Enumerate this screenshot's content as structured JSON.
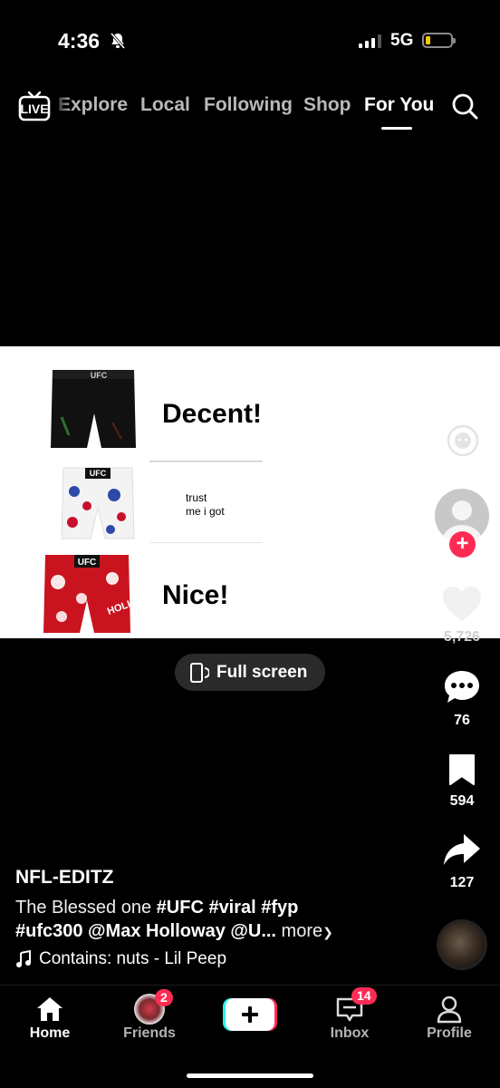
{
  "status_bar": {
    "time": "4:36",
    "network": "5G"
  },
  "top_nav": {
    "live_label": "LIVE",
    "tabs": [
      {
        "label": "Explore"
      },
      {
        "label": "Local"
      },
      {
        "label": "Following"
      },
      {
        "label": "Shop"
      },
      {
        "label": "For You"
      }
    ]
  },
  "video": {
    "text_1": "Decent!",
    "text_2_line_1": "trust",
    "text_2_line_2": "me i got",
    "text_3": "Nice!",
    "shorts_logo": "UFC",
    "shorts_side_text": "HOLLI"
  },
  "fullscreen": {
    "label": "Full screen"
  },
  "actions": {
    "likes": "5,726",
    "comments": "76",
    "bookmarks": "594",
    "shares": "127"
  },
  "post": {
    "username": "NFL-EDITZ",
    "caption_prefix": "The Blessed one ",
    "hashtags_line1": "#UFC #viral #fyp",
    "hashtag_line2": "#ufc300",
    "mention": " @Max Holloway @U...",
    "more_label": " more",
    "music": "Contains: nuts - Lil Peep"
  },
  "bottom_nav": {
    "home": "Home",
    "friends": "Friends",
    "friends_badge": "2",
    "inbox": "Inbox",
    "inbox_badge": "14",
    "profile": "Profile"
  },
  "colors": {
    "accent": "#fe2c55",
    "cyan": "#25f4ee",
    "background": "#000000"
  }
}
